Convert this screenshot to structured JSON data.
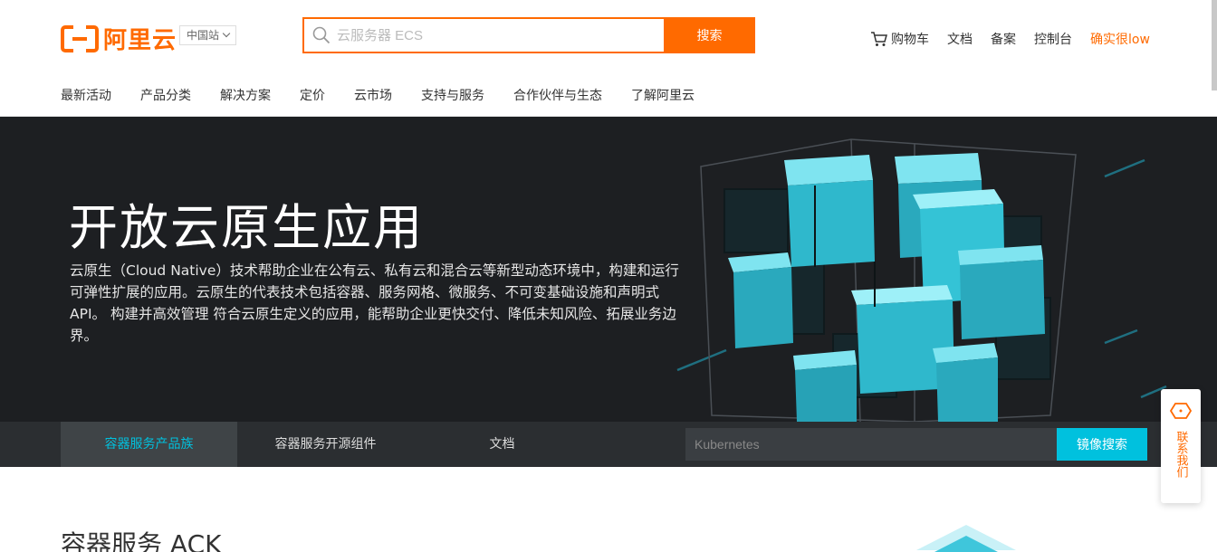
{
  "header": {
    "logo_text": "阿里云",
    "region": "中国站",
    "search": {
      "placeholder": "云服务器 ECS",
      "button": "搜索"
    },
    "utility": {
      "cart": "购物车",
      "docs": "文档",
      "beian": "备案",
      "console": "控制台",
      "user": "确实很low"
    },
    "nav": [
      "最新活动",
      "产品分类",
      "解决方案",
      "定价",
      "云市场",
      "支持与服务",
      "合作伙伴与生态",
      "了解阿里云"
    ]
  },
  "hero": {
    "title": "开放云原生应用",
    "description": "云原生（Cloud Native）技术帮助企业在公有云、私有云和混合云等新型动态环境中，构建和运行可弹性扩展的应用。云原生的代表技术包括容器、服务网格、微服务、不可变基础设施和声明式API。 构建并高效管理 符合云原生定义的应用，能帮助企业更快交付、降低未知风险、拓展业务边界。"
  },
  "subnav": {
    "tabs": [
      "容器服务产品族",
      "容器服务开源组件",
      "文档"
    ],
    "image_search": {
      "placeholder": "Kubernetes",
      "button": "镜像搜索"
    }
  },
  "section": {
    "title": "容器服务 ACK"
  },
  "contact": {
    "label": "联系我们"
  },
  "colors": {
    "brand": "#ff6a00",
    "accent": "#00c1de",
    "hero_bg": "#1d1f22",
    "subnav_bg": "#2b2e31"
  }
}
